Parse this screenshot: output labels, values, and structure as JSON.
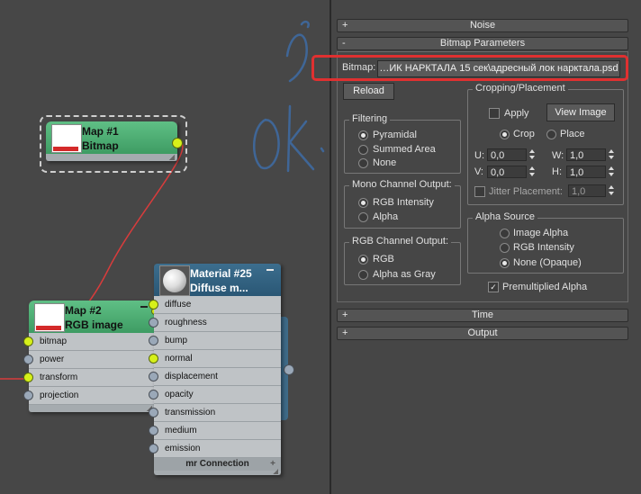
{
  "nodes": {
    "map1": {
      "title": "Map #1",
      "subtitle": "Bitmap"
    },
    "map2": {
      "title": "Map #2",
      "subtitle": "RGB image",
      "slots": [
        "bitmap",
        "power",
        "transform",
        "projection"
      ]
    },
    "material": {
      "title": "Material #25",
      "subtitle": "Diffuse m...",
      "slots": [
        "diffuse",
        "roughness",
        "bump",
        "normal",
        "displacement",
        "opacity",
        "transmission",
        "medium",
        "emission"
      ],
      "footer": "mr Connection"
    }
  },
  "rollouts": {
    "noise": {
      "sign": "+",
      "label": "Noise"
    },
    "bitmap_params": {
      "sign": "-",
      "label": "Bitmap Parameters"
    },
    "time": {
      "sign": "+",
      "label": "Time"
    },
    "output": {
      "sign": "+",
      "label": "Output"
    }
  },
  "bitmap": {
    "label": "Bitmap:",
    "path": "…ИК НАРКТАЛА 15 сек\\адресный лок нарктала.psd",
    "reload": "Reload"
  },
  "filtering": {
    "title": "Filtering",
    "options": [
      "Pyramidal",
      "Summed Area",
      "None"
    ],
    "selected": "Pyramidal"
  },
  "mono": {
    "title": "Mono Channel Output:",
    "options": [
      "RGB Intensity",
      "Alpha"
    ],
    "selected": "RGB Intensity"
  },
  "rgb": {
    "title": "RGB Channel Output:",
    "options": [
      "RGB",
      "Alpha as Gray"
    ],
    "selected": "RGB"
  },
  "cropping": {
    "title": "Cropping/Placement",
    "apply": "Apply",
    "view_image": "View Image",
    "crop": "Crop",
    "place": "Place",
    "u_label": "U:",
    "u": "0,0",
    "v_label": "V:",
    "v": "0,0",
    "w_label": "W:",
    "w": "1,0",
    "h_label": "H:",
    "h": "1,0",
    "jitter": "Jitter Placement:",
    "jitter_value": "1,0"
  },
  "alpha_source": {
    "title": "Alpha Source",
    "options": [
      "Image Alpha",
      "RGB Intensity",
      "None (Opaque)"
    ],
    "selected": "None (Opaque)"
  },
  "premult": {
    "label": "Premultiplied Alpha",
    "checked": true
  },
  "colors": {
    "highlight": "#e03030",
    "node_green": "#4fae74",
    "node_blue": "#2f5f80",
    "wire": "#d83c3c",
    "ink": "#3f6aa0"
  }
}
